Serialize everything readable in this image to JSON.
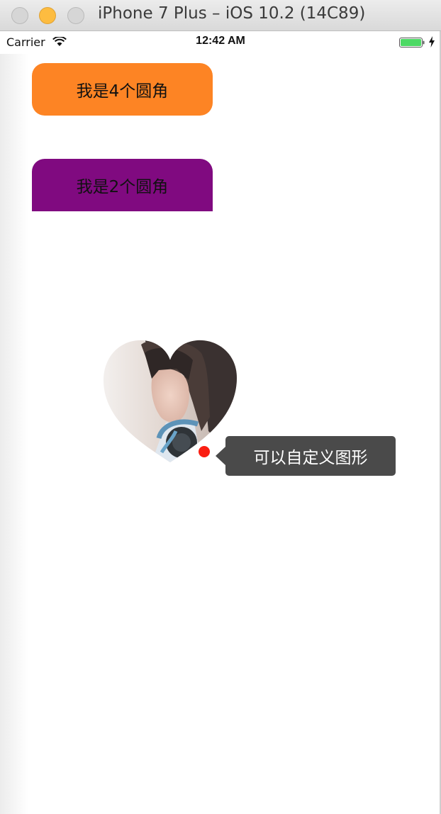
{
  "window": {
    "title": "iPhone 7 Plus – iOS 10.2 (14C89)"
  },
  "status_bar": {
    "carrier": "Carrier",
    "time": "12:42 AM",
    "wifi_icon": "wifi-icon",
    "battery_icon": "battery-icon",
    "charging_icon": "charging-bolt-icon"
  },
  "buttons": {
    "four_corners_label": "我是4个圆角",
    "two_corners_label": "我是2个圆角"
  },
  "heart": {
    "image": "heart-shaped-photo-girl-with-headphones"
  },
  "tooltip": {
    "text": "可以自定义图形"
  },
  "colors": {
    "orange_button": "#fd8424",
    "purple_button": "#800a80",
    "tooltip_bg": "#4a4a4a",
    "red_dot": "#fa1e12",
    "battery_green": "#4cd964"
  }
}
